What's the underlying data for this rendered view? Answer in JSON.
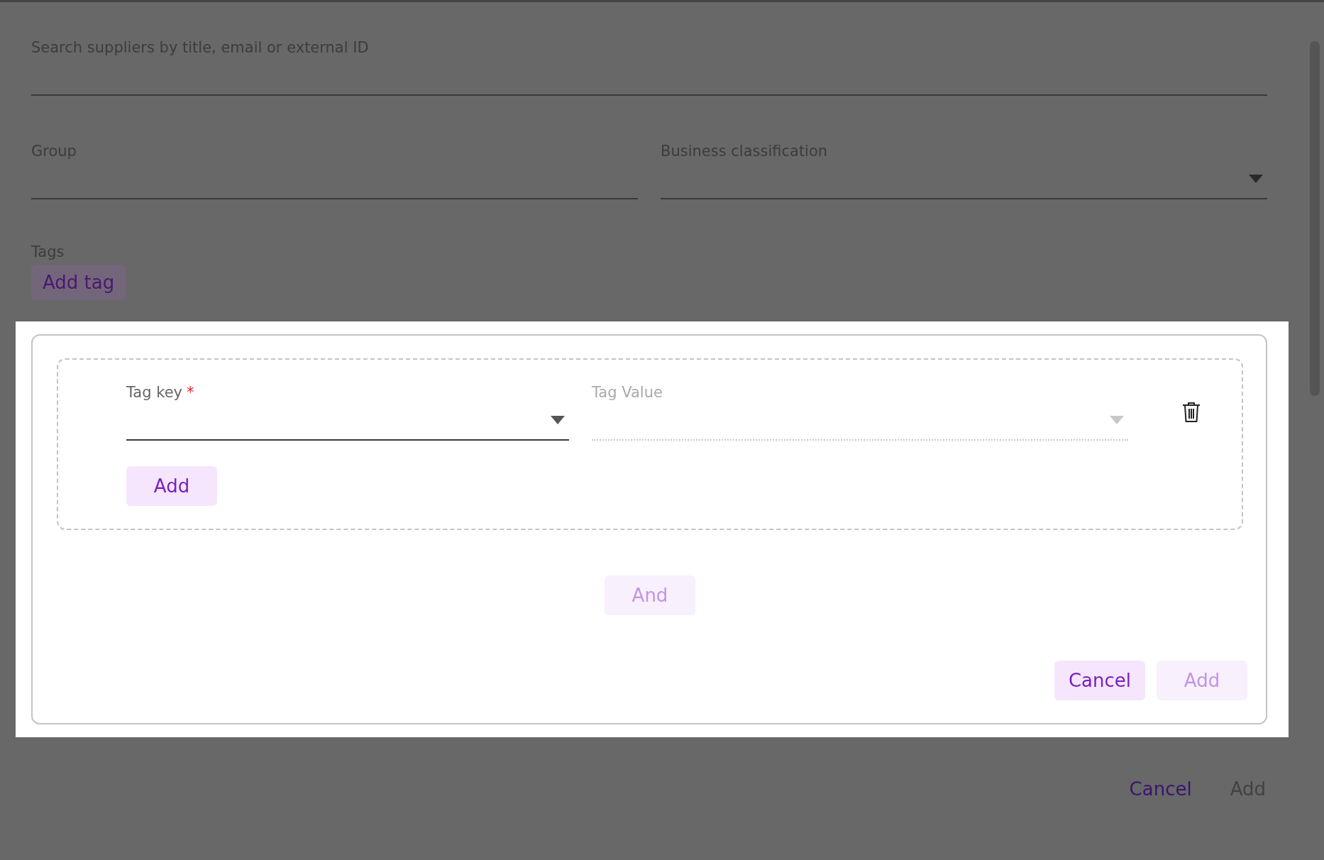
{
  "search": {
    "label": "Search suppliers by title, email or external ID"
  },
  "filters": [
    {
      "label": "Group",
      "kind": "text"
    },
    {
      "label": "Business classification",
      "kind": "select"
    }
  ],
  "tags": {
    "label": "Tags",
    "add_button": "Add tag"
  },
  "tag_builder": {
    "conditions": [
      {
        "key_label": "Tag key",
        "required_mark": "*",
        "value_label": "Tag Value",
        "value_disabled": true,
        "add_button": "Add"
      }
    ],
    "and_button": {
      "label": "And",
      "disabled": true
    },
    "actions": [
      {
        "label": "Cancel",
        "disabled": false
      },
      {
        "label": "Add",
        "disabled": true
      }
    ]
  },
  "footer": [
    {
      "label": "Cancel",
      "disabled": false
    },
    {
      "label": "Add",
      "disabled": true
    }
  ]
}
